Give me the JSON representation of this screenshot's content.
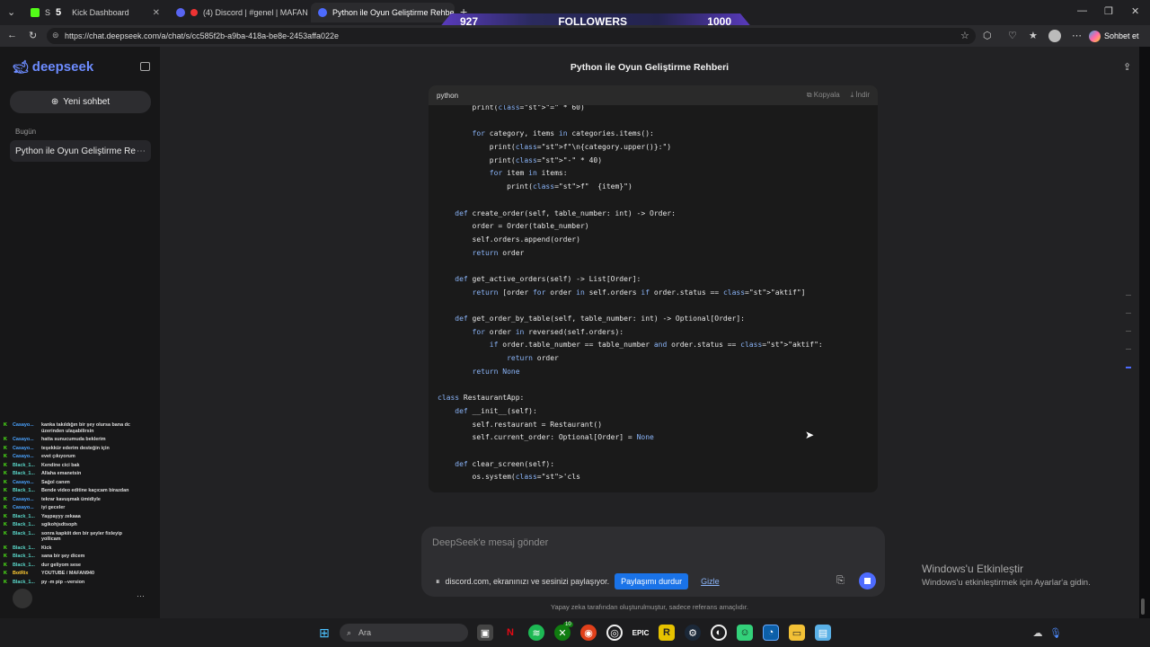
{
  "browser": {
    "tabs": [
      {
        "label": "S",
        "overlay_label": "5",
        "full_label": "Kick Dashboard",
        "color": "#53fc18"
      },
      {
        "label": "(4) Discord | #genel | MAFAN",
        "color": "#5865f2"
      },
      {
        "label": "Python ile Oyun Geliştirme Rehbe",
        "color": "#4d6bfe"
      }
    ],
    "new_tab": "+",
    "url": "https://chat.deepseek.com/a/chat/s/cc585f2b-a9ba-418a-be8e-2453affa022e",
    "profile_label": "Sohbet et"
  },
  "stream_overlay": {
    "left": "927",
    "center": "FOLLOWERS",
    "right": "1000"
  },
  "sidebar": {
    "logo": "deepseek",
    "new_chat": "Yeni sohbet",
    "section": "Bugün",
    "history": [
      "Python ile Oyun Geliştirme Re"
    ]
  },
  "page": {
    "title": "Python ile Oyun Geliştirme Rehberi"
  },
  "code_block": {
    "language": "python",
    "copy_label": "Kopyala",
    "download_label": "İndir",
    "lines": [
      "        print(\"=\" * 60)",
      "",
      "        for category, items in categories.items():",
      "            print(f\"\\n{category.upper()}:\")",
      "            print(\"-\" * 40)",
      "            for item in items:",
      "                print(f\"  {item}\")",
      "",
      "    def create_order(self, table_number: int) -> Order:",
      "        order = Order(table_number)",
      "        self.orders.append(order)",
      "        return order",
      "",
      "    def get_active_orders(self) -> List[Order]:",
      "        return [order for order in self.orders if order.status == \"aktif\"]",
      "",
      "    def get_order_by_table(self, table_number: int) -> Optional[Order]:",
      "        for order in reversed(self.orders):",
      "            if order.table_number == table_number and order.status == \"aktif\":",
      "                return order",
      "        return None",
      "",
      "class RestaurantApp:",
      "    def __init__(self):",
      "        self.restaurant = Restaurant()",
      "        self.current_order: Optional[Order] = None",
      "",
      "    def clear_screen(self):",
      "        os.system('cls"
    ]
  },
  "composer": {
    "placeholder": "DeepSeek'e mesaj gönder",
    "share_notice": "discord.com, ekranınızı ve sesinizi paylaşıyor.",
    "stop_share": "Paylaşımı durdur",
    "hide": "Gizle"
  },
  "footer": "Yapay zeka tarafından oluşturulmuştur, sadece referans amaçlıdır.",
  "watermark": {
    "title": "Windows'u Etkinleştir",
    "subtitle": "Windows'u etkinleştirmek için Ayarlar'a gidin."
  },
  "chat_overlay": [
    {
      "user": "Casayo...",
      "msg": "kanka takıldığın bir şey olursa bana dc üzerinden ulaşabilirsin",
      "color": "#4aa3ff"
    },
    {
      "user": "Casayo...",
      "msg": "hatta sunucumuda beklerim",
      "color": "#4aa3ff"
    },
    {
      "user": "Casayo...",
      "msg": "teşekkür ederim desteğin için",
      "color": "#4aa3ff"
    },
    {
      "user": "Casayo...",
      "msg": "evet çıkıyorum",
      "color": "#4aa3ff"
    },
    {
      "user": "Black_1...",
      "msg": "Kendine cici bak",
      "color": "#5ad7c9"
    },
    {
      "user": "Black_1...",
      "msg": "Allaha emanetsin",
      "color": "#5ad7c9"
    },
    {
      "user": "Casayo...",
      "msg": "Sağol canım",
      "color": "#4aa3ff"
    },
    {
      "user": "Black_1...",
      "msg": "Bende video editine kaçıcam birazdan",
      "color": "#5ad7c9"
    },
    {
      "user": "Casayo...",
      "msg": "tekrar kavuşmak ümidiyle",
      "color": "#4aa3ff"
    },
    {
      "user": "Casayo...",
      "msg": "iyi geceler",
      "color": "#4aa3ff"
    },
    {
      "user": "Black_1...",
      "msg": "Yaşpayyy zekaaa",
      "color": "#5ad7c9"
    },
    {
      "user": "Black_1...",
      "msg": "sgikohjsdtsoph",
      "color": "#5ad7c9"
    },
    {
      "user": "Black_1...",
      "msg": "sonra kapkiit den bir şeyler fixleyip yollicam",
      "color": "#5ad7c9"
    },
    {
      "user": "Black_1...",
      "msg": "Kick",
      "color": "#5ad7c9"
    },
    {
      "user": "Black_1...",
      "msg": "sana bir şey dicem",
      "color": "#5ad7c9"
    },
    {
      "user": "Black_1...",
      "msg": "dur geliyom sese",
      "color": "#5ad7c9"
    },
    {
      "user": "BotRix",
      "msg": "YOUTUBE / MAFAN940",
      "color": "#ffcc33"
    },
    {
      "user": "Black_1...",
      "msg": "py -m pip --version",
      "color": "#5ad7c9"
    }
  ],
  "taskbar": {
    "search_placeholder": "Ara",
    "badge": "10"
  }
}
